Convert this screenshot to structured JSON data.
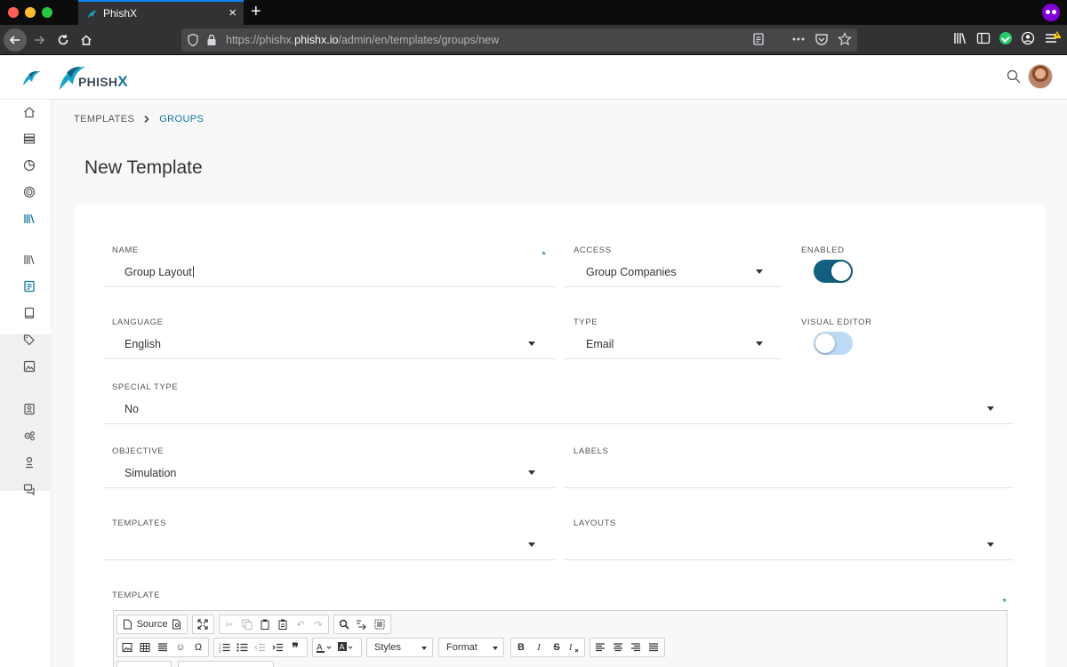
{
  "browser": {
    "tab_title": "PhishX",
    "url_prefix": "https://phishx.",
    "url_domain": "phishx.io",
    "url_path": "/admin/en/templates/groups/new",
    "new_tab_symbol": "+",
    "close_symbol": "×"
  },
  "app": {
    "logo_text": "PHISH",
    "logo_x": "X",
    "brand_color": "#11769c"
  },
  "breadcrumb": {
    "items": [
      "TEMPLATES",
      "GROUPS"
    ],
    "separator": "›"
  },
  "page": {
    "title": "New Template"
  },
  "form": {
    "name": {
      "label": "NAME",
      "value": "Group Layout",
      "required": "*"
    },
    "access": {
      "label": "ACCESS",
      "value": "Group Companies"
    },
    "enabled": {
      "label": "ENABLED",
      "state": "on"
    },
    "language": {
      "label": "LANGUAGE",
      "value": "English"
    },
    "type": {
      "label": "TYPE",
      "value": "Email"
    },
    "visual_editor": {
      "label": "VISUAL EDITOR",
      "state": "off"
    },
    "special_type": {
      "label": "SPECIAL TYPE",
      "value": "No"
    },
    "objective": {
      "label": "OBJECTIVE",
      "value": "Simulation"
    },
    "labels": {
      "label": "LABELS",
      "value": ""
    },
    "templates": {
      "label": "TEMPLATES",
      "value": ""
    },
    "layouts": {
      "label": "LAYOUTS",
      "value": ""
    },
    "template": {
      "label": "TEMPLATE",
      "required": "*"
    }
  },
  "editor": {
    "source_label": "Source",
    "styles_label": "Styles",
    "format_label": "Format",
    "bold": "B",
    "italic": "I",
    "strike": "S",
    "omega": "Ω",
    "quote": "❞"
  },
  "sidebar": {
    "items": [
      "home",
      "dashboard",
      "reports",
      "campaigns",
      "library",
      "library-alt",
      "templates",
      "pages",
      "tags",
      "media",
      "contacts",
      "settings",
      "users",
      "messages"
    ]
  }
}
